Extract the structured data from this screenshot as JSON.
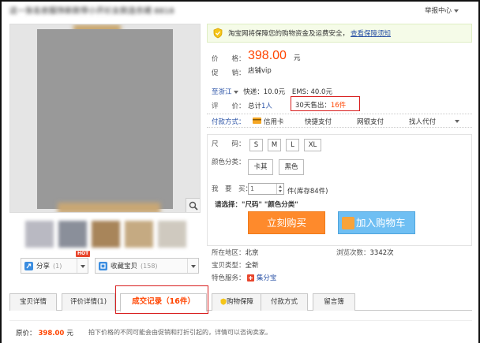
{
  "header": {
    "title": "这一张名依服饰新款带小开衫女款连衣裙 8818",
    "report": "举报中心"
  },
  "gallery": {
    "share": {
      "label": "分享",
      "count": "(1)",
      "hot": "HOT"
    },
    "collect": {
      "label": "收藏宝贝",
      "count": "(158)"
    }
  },
  "guarantee": {
    "text": "淘宝网将保障您的购物资金及运费安全，",
    "link": "查看保障须知"
  },
  "product": {
    "price_label": "价　　格：",
    "price": "398.00",
    "price_unit": "元",
    "promo_label": "促　　销：",
    "promo": "店铺vip",
    "ship_to": "至浙江",
    "express": "快递：10.0元",
    "ems": "EMS: 40.0元",
    "review_label": "评　　价：",
    "review_total": "总计",
    "review_count": "1人",
    "sold_30d": "30天售出：",
    "sold_count": "16件",
    "payment_label": "付款方式：",
    "payment_methods": [
      "信用卡",
      "快捷支付",
      "网银支付",
      "找人代付"
    ]
  },
  "options": {
    "size_label": "尺　　码：",
    "sizes": [
      "S",
      "M",
      "L",
      "XL"
    ],
    "color_label": "颜色分类：",
    "colors": [
      "卡其",
      "黑色"
    ],
    "qty_label": "我　要　买：",
    "qty_value": "1",
    "qty_unit": "件",
    "stock": "(库存84件)",
    "prompt_label": "请选择：",
    "prompt_value": "\"尺码\" \"颜色分类\"",
    "buy_now": "立刻购买",
    "add_cart": "加入购物车"
  },
  "meta": {
    "location_label": "所在地区：",
    "location": "北京",
    "views_label": "浏览次数：",
    "views": "3342次",
    "type_label": "宝贝类型：",
    "type": "全新",
    "service_label": "特色服务：",
    "service": "集分宝"
  },
  "tabs": [
    "宝贝详情",
    "评价详情(1)",
    "成交记录（16件）",
    "购物保障",
    "付款方式",
    "留言簿"
  ],
  "bottom": {
    "price_label": "原价：",
    "price": "398.00",
    "unit": "元",
    "note": "拍下价格的不同可能会由促销和打折引起的，详情可以咨询卖家。"
  },
  "colors": {
    "accent": "#ff4400",
    "highlight_box": "#d81e1e",
    "link": "#2a52a6",
    "buy": "#fe8a2c",
    "cart": "#6fbff3"
  }
}
